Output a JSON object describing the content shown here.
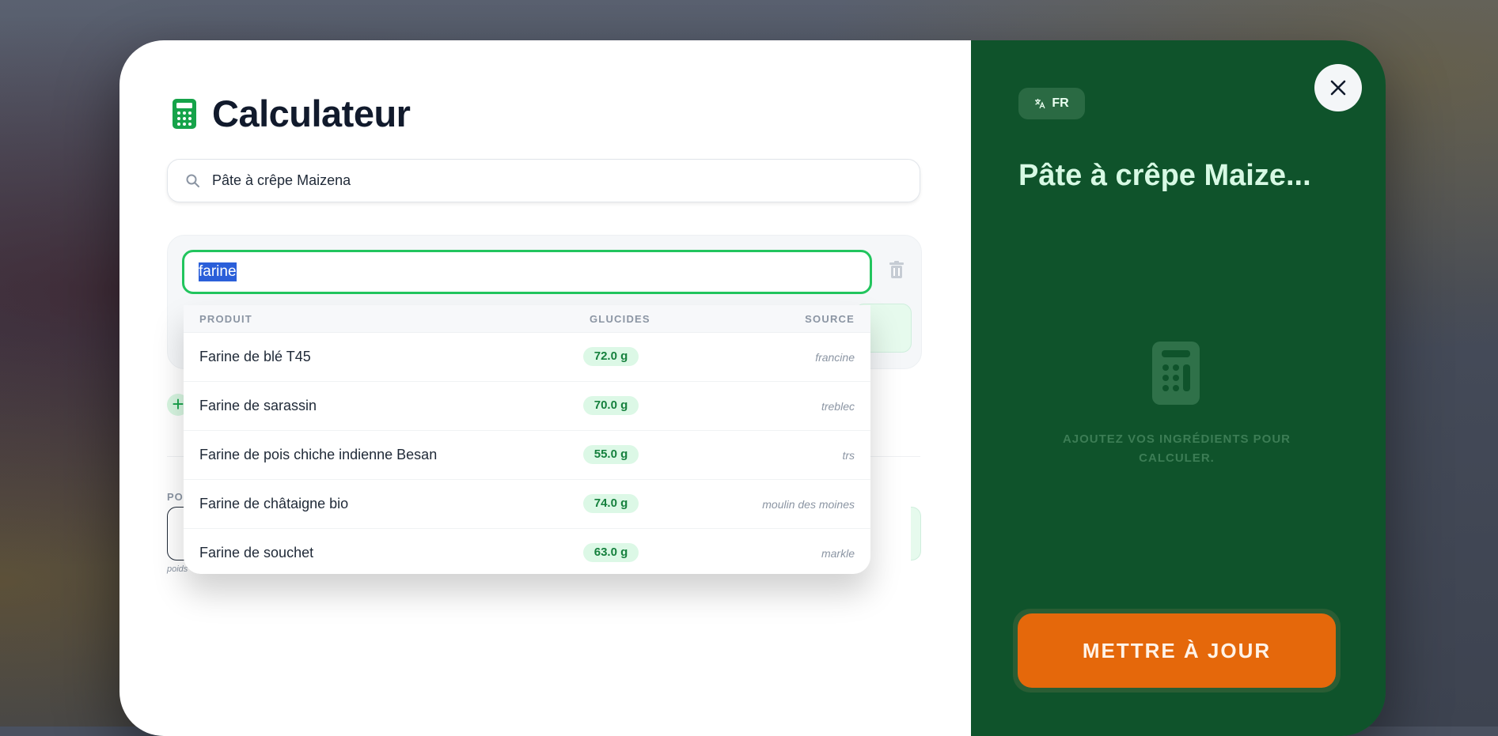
{
  "left": {
    "title": "Calculateur",
    "search": {
      "value": "Pâte à crêpe Maizena"
    },
    "ingredient": {
      "value": "farine"
    },
    "portion_label": "PO",
    "portion_hint": "poids"
  },
  "dropdown": {
    "headers": {
      "product": "PRODUIT",
      "carbs": "GLUCIDES",
      "source": "SOURCE"
    },
    "rows": [
      {
        "name": "Farine de blé T45",
        "carbs": "72.0 g",
        "source": "francine"
      },
      {
        "name": "Farine de sarassin",
        "carbs": "70.0 g",
        "source": "treblec"
      },
      {
        "name": "Farine de pois chiche indienne Besan",
        "carbs": "55.0 g",
        "source": "trs"
      },
      {
        "name": "Farine de châtaigne bio",
        "carbs": "74.0 g",
        "source": "moulin des moines"
      },
      {
        "name": "Farine de souchet",
        "carbs": "63.0 g",
        "source": "markle"
      }
    ]
  },
  "right": {
    "lang": "FR",
    "recipe_title": "Pâte à crêpe Maize...",
    "empty_text": "AJOUTEZ VOS INGRÉDIENTS POUR CALCULER.",
    "update_label": "METTRE À JOUR"
  },
  "colors": {
    "accent_green": "#22c55e",
    "panel_green": "#0f532b",
    "update_orange": "#e5680b"
  },
  "icons": [
    "calculator-icon",
    "search-icon",
    "trash-icon",
    "plus-icon",
    "close-icon",
    "translate-icon"
  ]
}
